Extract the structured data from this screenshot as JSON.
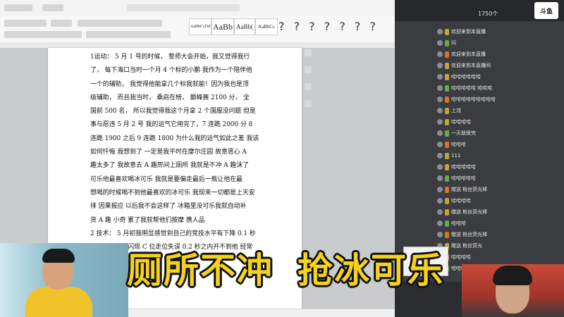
{
  "editor": {
    "styles": [
      "AaBbCcDd",
      "AaBb",
      "AaBb(",
      "AaBbCc"
    ],
    "question_marks": "? ? ? ? ? ? ?",
    "doc_lines": [
      "1运动：   5 月 1 号的时候，   誓师大会开始，我又觉得我行",
      "了，  每下海口当时一个月 4 个标的小鹏  我作为一个陪伴他",
      "一个的辅助，    我觉得他能拿几个标我就能！因为我也是顶",
      "级辅助，   而且我当时，   桑启在榜，   巅峰赛 2100 分，   全",
      "国前 500 名，   所以我觉得我这个月拿 2 个国服没问题  但是",
      "事与愿违 5 月 2 号  我的运气它用完了，7 连跪 2000 分    8",
      "连跪 1900  之后 9 连跪 1800  为什么我的运气如此之差  我该",
      "如何忏悔  我想到了  一定是我平时在摩尔庄园  故意恶心 A",
      "趣太多了  我故意去 A 趣房间上厕所  我就是不冲   A 趣沫了",
      "可乐他最喜欢喝冰可乐  我就是要偏走最后一瓶让他在最",
      "想喝的时候喝不到他最喜欢的冰可乐  我现来一切都是上天安",
      "排  因果报应  以后我不会这样了  冰箱里没可乐我就自动补",
      "货 A 趣  小奇  累了我就帮他们按摩  携人品",
      "2 技术：   5 月初我明显感觉到自己的竞技水平有下降  0.1 秒",
      "之内按不出来闪现  C 位走位失误 0.2 秒之内开不到他  经常"
    ]
  },
  "chat": {
    "title": "1750个",
    "logo": "斗鱼",
    "messages": [
      {
        "tag": "",
        "text": "欢迎来到本直播"
      },
      {
        "tag": "",
        "text": "问"
      },
      {
        "tag": "",
        "text": "欢迎来到本直播"
      },
      {
        "tag": "",
        "text": "欢迎来到本直播间"
      },
      {
        "tag": "",
        "text": "哈哈哈哈哈哈"
      },
      {
        "tag": "",
        "text": "哈哈哈哈哈   哈哈哈"
      },
      {
        "tag": "",
        "text": "哈哈哈哈哈哈哈哈哈"
      },
      {
        "tag": "",
        "text": "上流"
      },
      {
        "tag": "",
        "text": "哈哈哈哈"
      },
      {
        "tag": "",
        "text": "一天就很完"
      },
      {
        "tag": "",
        "text": "哈哈哈"
      },
      {
        "tag": "",
        "text": "111"
      },
      {
        "tag": "",
        "text": "哈哈哈哈哈"
      },
      {
        "tag": "",
        "text": "哈哈哈哈哈"
      },
      {
        "tag": "",
        "text": "赠送 粉丝荧光棒"
      },
      {
        "tag": "",
        "text": "哈哈哈哈"
      },
      {
        "tag": "",
        "text": "赠送 粉丝荧光棒"
      },
      {
        "tag": "",
        "text": "哈哈哈"
      },
      {
        "tag": "",
        "text": "赠送 粉丝荧光棒"
      },
      {
        "tag": "",
        "text": "赠送 粉丝荧光"
      },
      {
        "tag": "",
        "text": "哈哈哈哈"
      },
      {
        "tag": "",
        "text": "哈哈哈"
      }
    ]
  },
  "caption": {
    "part1": "厕所不冲",
    "part2": "抢冰可乐"
  }
}
